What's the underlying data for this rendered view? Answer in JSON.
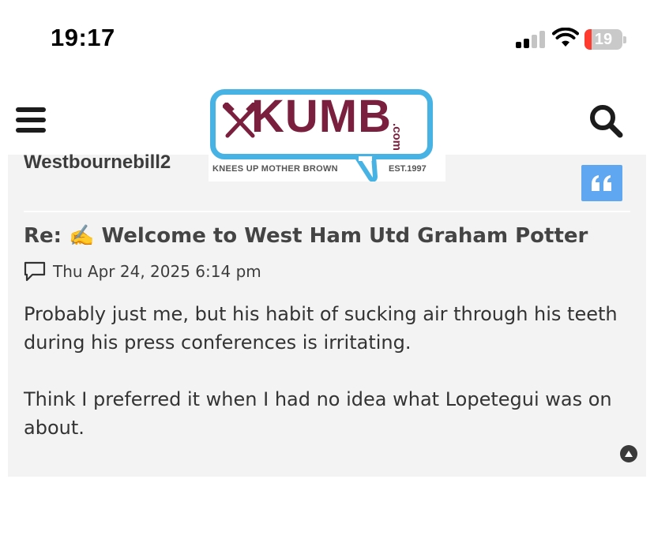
{
  "status_bar": {
    "time": "19:17",
    "battery_level": "19",
    "battery_fraction": 0.19,
    "battery_color": "#ff3b30",
    "signal_bars": 2,
    "signal_bars_total": 4
  },
  "header": {
    "menu_icon": "hamburger-menu-icon",
    "search_icon": "search-icon",
    "logo": {
      "wordmark": "KUMB",
      "domain_suffix": ".com",
      "tagline": "KNEES UP MOTHER BROWN",
      "established": "EST.1997",
      "border_color": "#47b2e4",
      "wordmark_color": "#7a1f3d"
    }
  },
  "post": {
    "author": "Westbournebill2",
    "quote_icon": "quote-icon",
    "title": "Re: ✍️ Welcome to West Ham Utd Graham Potter",
    "date_icon": "speech-bubble-icon",
    "date": "Thu Apr 24, 2025 6:14 pm",
    "body": [
      "Probably just me, but his habit of sucking air through his teeth during his press conferences is irritating.",
      "Think I preferred it when I had no idea what Lopetegui was on about."
    ],
    "scroll_top_icon": "arrow-up-circle-icon"
  },
  "colors": {
    "card_background": "#f3f3f3",
    "quote_button": "#5fa7f0",
    "text": "#333333"
  }
}
